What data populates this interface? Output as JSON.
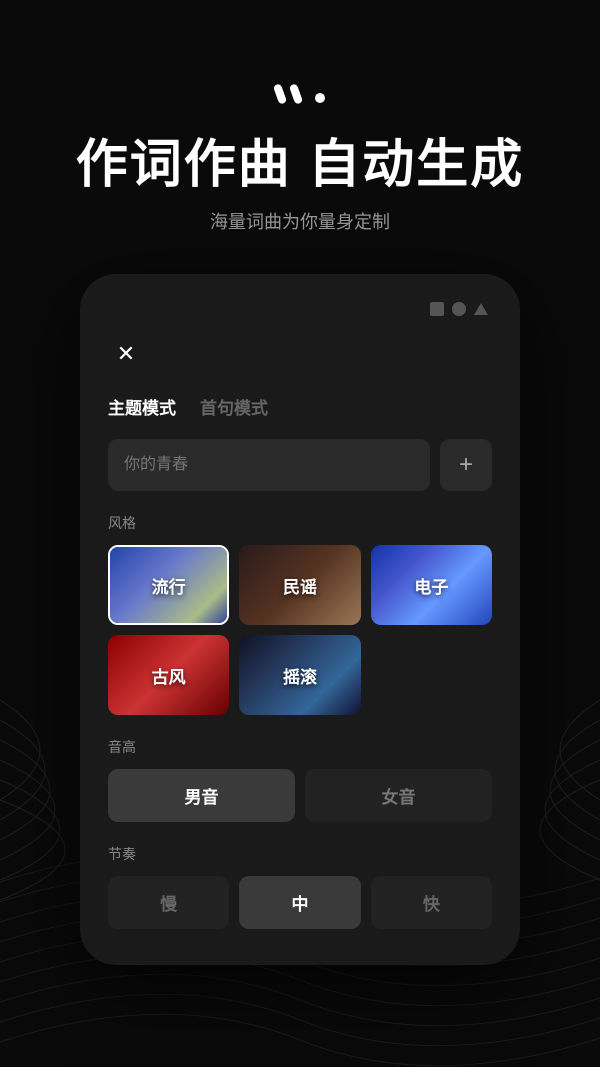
{
  "app": {
    "background_color": "#0a0a0a"
  },
  "top": {
    "logo_symbol": "//.",
    "headline": "作词作曲  自动生成",
    "subtitle": "海量词曲为你量身定制"
  },
  "phone": {
    "status_icons": [
      "square",
      "circle",
      "triangle"
    ],
    "close_label": "×",
    "tabs": [
      {
        "id": "theme",
        "label": "主题模式",
        "active": true
      },
      {
        "id": "first",
        "label": "首句模式",
        "active": false
      }
    ],
    "input_placeholder": "你的青春",
    "add_button_label": "+",
    "style_section_label": "风格",
    "styles": [
      {
        "id": "liuxing",
        "label": "流行",
        "selected": true,
        "bg_class": "bg-liuxing"
      },
      {
        "id": "minyao",
        "label": "民谣",
        "selected": false,
        "bg_class": "bg-minyao"
      },
      {
        "id": "dianzi",
        "label": "电子",
        "selected": false,
        "bg_class": "bg-dianzi"
      },
      {
        "id": "gufeng",
        "label": "古风",
        "selected": false,
        "bg_class": "bg-gufeng"
      },
      {
        "id": "yaogn",
        "label": "摇滚",
        "selected": false,
        "bg_class": "bg-yaogn"
      }
    ],
    "pitch_section_label": "音高",
    "pitch_options": [
      {
        "id": "male",
        "label": "男音",
        "active": true
      },
      {
        "id": "female",
        "label": "女音",
        "active": false
      }
    ],
    "tempo_section_label": "节奏",
    "tempo_options": [
      {
        "id": "slow",
        "label": "慢",
        "active": false
      },
      {
        "id": "mid",
        "label": "中",
        "active": true
      },
      {
        "id": "fast",
        "label": "快",
        "active": false
      }
    ]
  }
}
